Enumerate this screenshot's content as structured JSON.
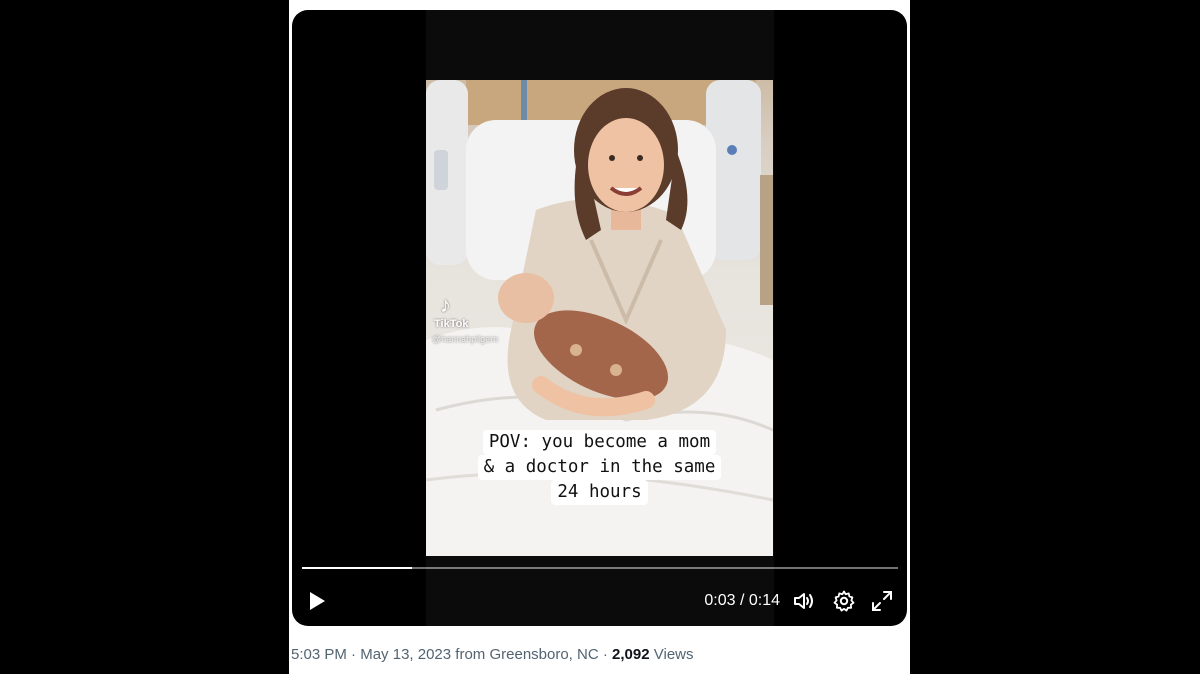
{
  "video": {
    "caption_lines": [
      "POV: you become a mom",
      "& a doctor in the same",
      "24 hours"
    ],
    "watermark": {
      "brand": "TikTok",
      "handle": "@hannahpilgern"
    },
    "progress_fraction": 0.185,
    "time": {
      "current": "0:03",
      "separator": "/",
      "total": "0:14"
    },
    "controls": {
      "play": "play-icon",
      "volume": "volume-icon",
      "settings": "gear-icon",
      "fullscreen": "fullscreen-icon"
    }
  },
  "meta": {
    "time": "5:03 PM",
    "sep1": "·",
    "date": "May 13, 2023",
    "location_prefix": "from",
    "location": "Greensboro, NC",
    "sep2": "·",
    "views_count": "2,092",
    "views_label": "Views"
  },
  "colors": {
    "meta_text": "#536471",
    "meta_strong": "#0f1419",
    "player_bg": "#000000"
  }
}
